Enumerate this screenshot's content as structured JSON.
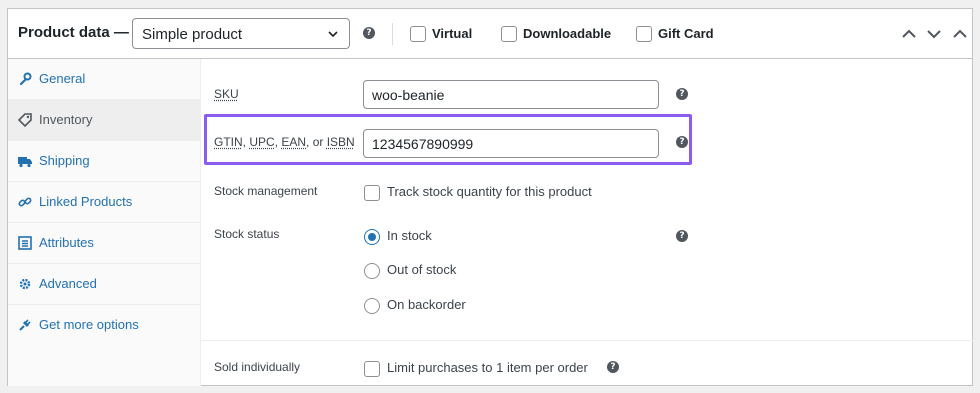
{
  "header": {
    "title": "Product data —",
    "product_type": "Simple product",
    "options": [
      {
        "label": "Virtual",
        "checked": false
      },
      {
        "label": "Downloadable",
        "checked": false
      },
      {
        "label": "Gift Card",
        "checked": false
      }
    ]
  },
  "sidebar": {
    "tabs": [
      {
        "label": "General",
        "icon": "wrench-icon",
        "active": false
      },
      {
        "label": "Inventory",
        "icon": "tag-icon",
        "active": true
      },
      {
        "label": "Shipping",
        "icon": "truck-icon",
        "active": false
      },
      {
        "label": "Linked Products",
        "icon": "link-icon",
        "active": false
      },
      {
        "label": "Attributes",
        "icon": "list-icon",
        "active": false
      },
      {
        "label": "Advanced",
        "icon": "gear-icon",
        "active": false
      },
      {
        "label": "Get more options",
        "icon": "plugin-icon",
        "active": false
      }
    ]
  },
  "inventory": {
    "sku": {
      "label": "SKU",
      "value": "woo-beanie"
    },
    "gtin": {
      "label_parts": [
        "GTIN",
        ", ",
        "UPC",
        ", ",
        "EAN",
        ", or ",
        "ISBN"
      ],
      "value": "1234567890999"
    },
    "stock_management": {
      "label": "Stock management",
      "checkbox_label": "Track stock quantity for this product",
      "checked": false
    },
    "stock_status": {
      "label": "Stock status",
      "options": [
        {
          "label": "In stock",
          "selected": true
        },
        {
          "label": "Out of stock",
          "selected": false
        },
        {
          "label": "On backorder",
          "selected": false
        }
      ]
    },
    "sold_individually": {
      "label": "Sold individually",
      "checkbox_label": "Limit purchases to 1 item per order",
      "checked": false
    }
  },
  "colors": {
    "link": "#2271b1",
    "highlight": "#8c5cf0",
    "text": "#1d2327"
  }
}
